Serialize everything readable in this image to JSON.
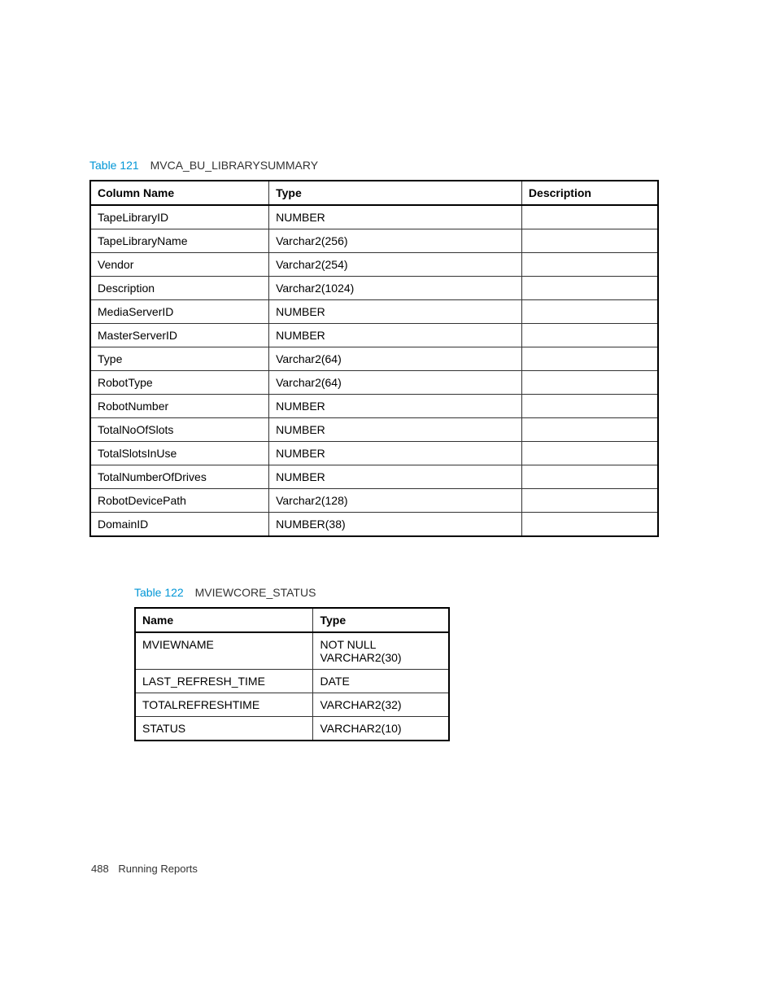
{
  "tables": [
    {
      "number": "Table 121",
      "title": "MVCA_BU_LIBRARYSUMMARY",
      "headers": [
        "Column Name",
        "Type",
        "Description"
      ],
      "rows": [
        [
          "TapeLibraryID",
          "NUMBER",
          ""
        ],
        [
          "TapeLibraryName",
          "Varchar2(256)",
          ""
        ],
        [
          "Vendor",
          "Varchar2(254)",
          ""
        ],
        [
          "Description",
          "Varchar2(1024)",
          ""
        ],
        [
          "MediaServerID",
          "NUMBER",
          ""
        ],
        [
          "MasterServerID",
          "NUMBER",
          ""
        ],
        [
          "Type",
          "Varchar2(64)",
          ""
        ],
        [
          "RobotType",
          "Varchar2(64)",
          ""
        ],
        [
          "RobotNumber",
          "NUMBER",
          ""
        ],
        [
          "TotalNoOfSlots",
          "NUMBER",
          ""
        ],
        [
          "TotalSlotsInUse",
          "NUMBER",
          ""
        ],
        [
          "TotalNumberOfDrives",
          "NUMBER",
          ""
        ],
        [
          "RobotDevicePath",
          "Varchar2(128)",
          ""
        ],
        [
          "DomainID",
          "NUMBER(38)",
          ""
        ]
      ]
    },
    {
      "number": "Table 122",
      "title": "MVIEWCORE_STATUS",
      "headers": [
        "Name",
        "Type"
      ],
      "rows": [
        [
          "MVIEWNAME",
          "NOT NULL VARCHAR2(30)"
        ],
        [
          "LAST_REFRESH_TIME",
          "DATE"
        ],
        [
          "TOTALREFRESHTIME",
          "VARCHAR2(32)"
        ],
        [
          " STATUS",
          "VARCHAR2(10)"
        ]
      ]
    }
  ],
  "footer": {
    "pageNumber": "488",
    "section": "Running Reports"
  }
}
